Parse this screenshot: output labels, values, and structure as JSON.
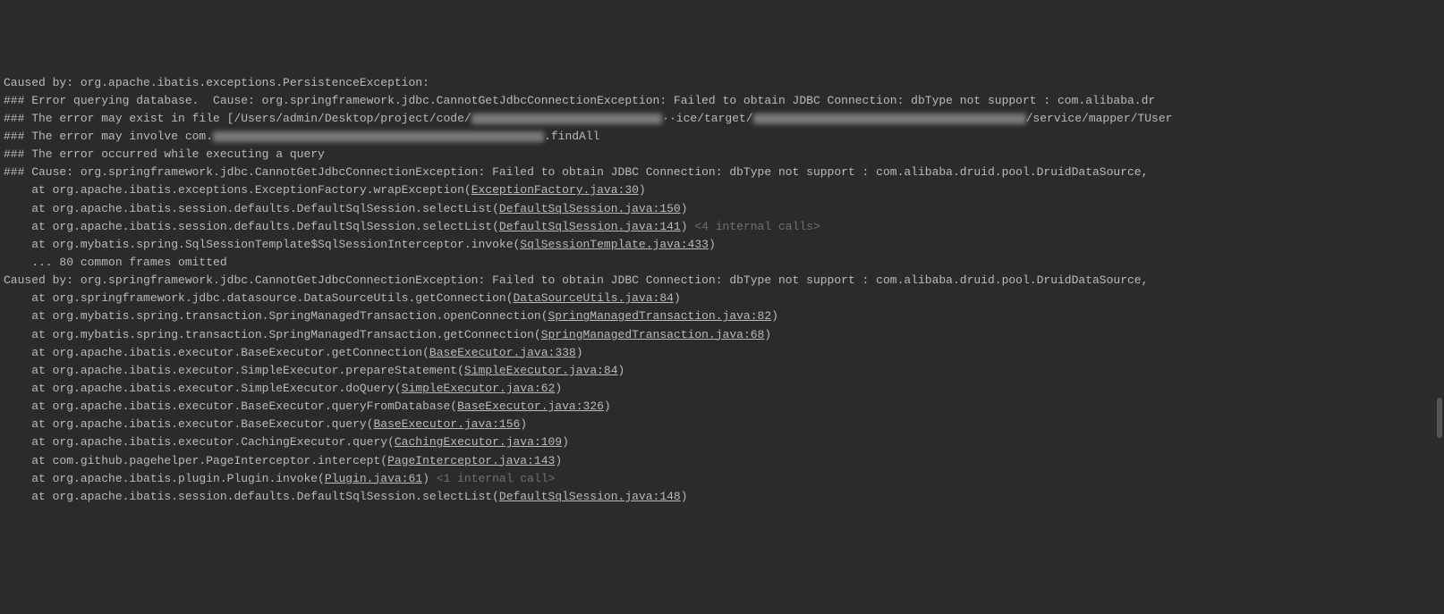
{
  "lines": [
    {
      "prefix": "Caused by: org.apache.ibatis.exceptions.PersistenceException:"
    },
    {
      "prefix": "### Error querying database.  Cause: org.springframework.jdbc.CannotGetJdbcConnectionException: Failed to obtain JDBC Connection: dbType not support : com.alibaba.dr"
    },
    {
      "prefix": "### The error may exist in file [/Users/admin/Desktop/project/code/",
      "redact_w": 610,
      "suffix": "/service/mapper/TUser",
      "mid": "··ice/target/"
    },
    {
      "prefix": "### The error may involve com.",
      "redact_w": 370,
      "suffix": ".findAll"
    },
    {
      "prefix": "### The error occurred while executing a query"
    },
    {
      "prefix": "### Cause: org.springframework.jdbc.CannotGetJdbcConnectionException: Failed to obtain JDBC Connection: dbType not support : com.alibaba.druid.pool.DruidDataSource,"
    },
    {
      "indent": "    at ",
      "text": "org.apache.ibatis.exceptions.ExceptionFactory.wrapException(",
      "link": "ExceptionFactory.java:30",
      "tail": ")"
    },
    {
      "indent": "    at ",
      "text": "org.apache.ibatis.session.defaults.DefaultSqlSession.selectList(",
      "link": "DefaultSqlSession.java:150",
      "tail": ")"
    },
    {
      "indent": "    at ",
      "text": "org.apache.ibatis.session.defaults.DefaultSqlSession.selectList(",
      "link": "DefaultSqlSession.java:141",
      "tail": ")",
      "dim": " <4 internal calls>"
    },
    {
      "indent": "    at ",
      "text": "org.mybatis.spring.SqlSessionTemplate$SqlSessionInterceptor.invoke(",
      "link": "SqlSessionTemplate.java:433",
      "tail": ")"
    },
    {
      "prefix": "    ... 80 common frames omitted"
    },
    {
      "prefix": "Caused by: org.springframework.jdbc.CannotGetJdbcConnectionException: Failed to obtain JDBC Connection: dbType not support : com.alibaba.druid.pool.DruidDataSource,"
    },
    {
      "indent": "    at ",
      "text": "org.springframework.jdbc.datasource.DataSourceUtils.getConnection(",
      "link": "DataSourceUtils.java:84",
      "tail": ")"
    },
    {
      "indent": "    at ",
      "text": "org.mybatis.spring.transaction.SpringManagedTransaction.openConnection(",
      "link": "SpringManagedTransaction.java:82",
      "tail": ")"
    },
    {
      "indent": "    at ",
      "text": "org.mybatis.spring.transaction.SpringManagedTransaction.getConnection(",
      "link": "SpringManagedTransaction.java:68",
      "tail": ")"
    },
    {
      "indent": "    at ",
      "text": "org.apache.ibatis.executor.BaseExecutor.getConnection(",
      "link": "BaseExecutor.java:338",
      "tail": ")"
    },
    {
      "indent": "    at ",
      "text": "org.apache.ibatis.executor.SimpleExecutor.prepareStatement(",
      "link": "SimpleExecutor.java:84",
      "tail": ")"
    },
    {
      "indent": "    at ",
      "text": "org.apache.ibatis.executor.SimpleExecutor.doQuery(",
      "link": "SimpleExecutor.java:62",
      "tail": ")"
    },
    {
      "indent": "    at ",
      "text": "org.apache.ibatis.executor.BaseExecutor.queryFromDatabase(",
      "link": "BaseExecutor.java:326",
      "tail": ")"
    },
    {
      "indent": "    at ",
      "text": "org.apache.ibatis.executor.BaseExecutor.query(",
      "link": "BaseExecutor.java:156",
      "tail": ")"
    },
    {
      "indent": "    at ",
      "text": "org.apache.ibatis.executor.CachingExecutor.query(",
      "link": "CachingExecutor.java:109",
      "tail": ")"
    },
    {
      "indent": "    at ",
      "text": "com.github.pagehelper.PageInterceptor.intercept(",
      "link": "PageInterceptor.java:143",
      "tail": ")"
    },
    {
      "indent": "    at ",
      "text": "org.apache.ibatis.plugin.Plugin.invoke(",
      "link": "Plugin.java:61",
      "tail": ")",
      "dim": " <1 internal call>"
    },
    {
      "indent": "    at ",
      "text": "org.apache.ibatis.session.defaults.DefaultSqlSession.selectList(",
      "link": "DefaultSqlSession.java:148",
      "tail": ")"
    }
  ]
}
